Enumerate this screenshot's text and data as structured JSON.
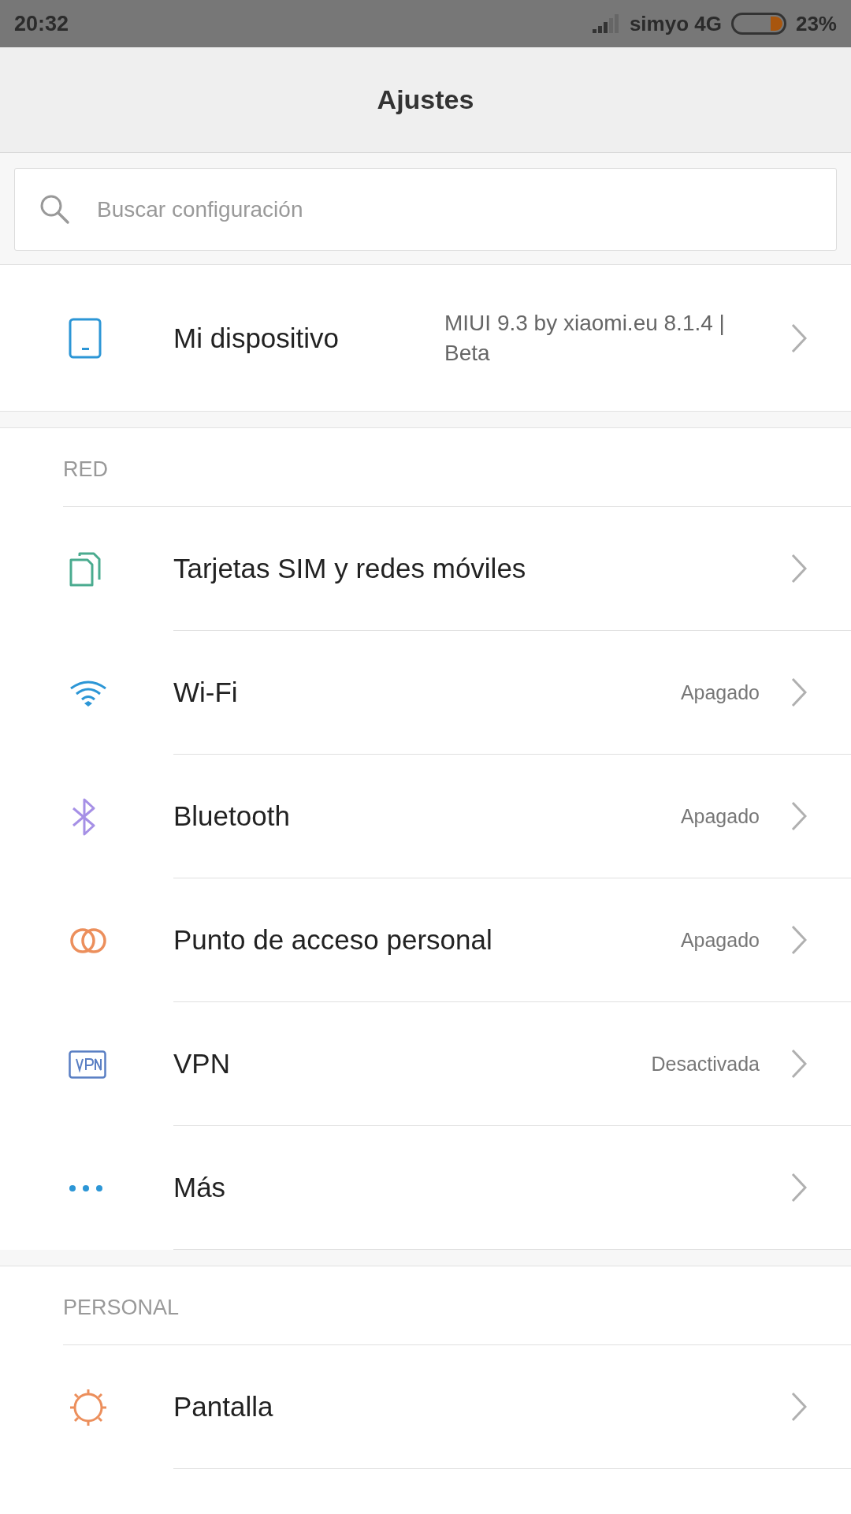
{
  "status_bar": {
    "time": "20:32",
    "carrier": "simyo 4G",
    "battery": "23%"
  },
  "header": {
    "title": "Ajustes"
  },
  "search": {
    "placeholder": "Buscar configuración"
  },
  "device": {
    "label": "Mi dispositivo",
    "value": "MIUI 9.3 by xiaomi.eu 8.1.4 | Beta"
  },
  "sections": [
    {
      "title": "RED",
      "items": [
        {
          "label": "Tarjetas SIM y redes móviles"
        },
        {
          "label": "Wi-Fi",
          "value": "Apagado"
        },
        {
          "label": "Bluetooth",
          "value": "Apagado"
        },
        {
          "label": "Punto de acceso personal",
          "value": "Apagado"
        },
        {
          "label": "VPN",
          "value": "Desactivada"
        },
        {
          "label": "Más"
        }
      ]
    },
    {
      "title": "PERSONAL",
      "items": [
        {
          "label": "Pantalla"
        }
      ]
    }
  ]
}
